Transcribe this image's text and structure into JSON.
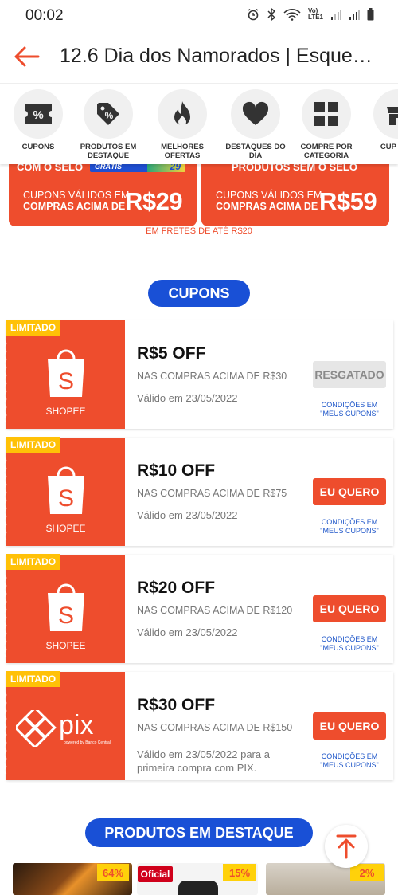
{
  "status_bar": {
    "time": "00:02",
    "network_label_top": "Vo)",
    "network_label_bottom": "LTE1"
  },
  "header": {
    "title": "12.6 Dia dos Namorados | Esque…"
  },
  "categories": [
    {
      "label": "CUPONS",
      "icon": "coupon-icon"
    },
    {
      "label": "PRODUTOS EM DESTAQUE",
      "icon": "price-tag-icon"
    },
    {
      "label": "MELHORES OFERTAS",
      "icon": "flame-icon"
    },
    {
      "label": "DESTAQUES DO DIA",
      "icon": "heart-icon"
    },
    {
      "label": "COMPRE POR CATEGORIA",
      "icon": "grid-icon"
    },
    {
      "label": "CUP DE L",
      "icon": "store-icon"
    }
  ],
  "banners": [
    {
      "top_text": "COM O SELO",
      "badge_text": "GRÁTIS",
      "badge_amount": "29",
      "line1": "CUPONS VÁLIDOS EM",
      "line2": "COMPRAS ACIMA DE",
      "amount": "R$29"
    },
    {
      "top_text": "PRODUTOS SEM O SELO",
      "line1": "CUPONS VÁLIDOS EM",
      "line2": "COMPRAS ACIMA DE",
      "amount": "R$59"
    }
  ],
  "frete_note": "EM FRETES DE ATÉ R$20",
  "sections": {
    "cupons": "CUPONS",
    "produtos_destaque": "PRODUTOS EM DESTAQUE"
  },
  "coupons": [
    {
      "badge": "LIMITADO",
      "brand": "SHOPEE",
      "amount": "R$5 OFF",
      "min": "NAS COMPRAS ACIMA DE R$30",
      "valid": "Válido em 23/05/2022",
      "button": "RESGATADO",
      "button_state": "claimed",
      "conditions": "CONDIÇÕES EM \"MEUS CUPONS\""
    },
    {
      "badge": "LIMITADO",
      "brand": "SHOPEE",
      "amount": "R$10 OFF",
      "min": "NAS COMPRAS ACIMA DE R$75",
      "valid": "Válido em 23/05/2022",
      "button": "EU QUERO",
      "button_state": "available",
      "conditions": "CONDIÇÕES EM \"MEUS CUPONS\""
    },
    {
      "badge": "LIMITADO",
      "brand": "SHOPEE",
      "amount": "R$20 OFF",
      "min": "NAS COMPRAS ACIMA DE R$120",
      "valid": "Válido em 23/05/2022",
      "button": "EU QUERO",
      "button_state": "available",
      "conditions": "CONDIÇÕES EM \"MEUS CUPONS\""
    },
    {
      "badge": "LIMITADO",
      "brand": "pix",
      "brand_sub": "powered by Banco Central",
      "amount": "R$30 OFF",
      "min": "NAS COMPRAS ACIMA DE R$150",
      "valid": "Válido em 23/05/2022 para a primeira compra com PIX.",
      "button": "EU QUERO",
      "button_state": "available",
      "conditions": "CONDIÇÕES EM \"MEUS CUPONS\""
    }
  ],
  "products": [
    {
      "discount": "64%"
    },
    {
      "label": "Oficial",
      "discount": "15%"
    },
    {
      "discount": "2%"
    }
  ],
  "colors": {
    "shopee_orange": "#ee4d2d",
    "pill_blue": "#1950d6",
    "limited_yellow": "#ffc107",
    "link_blue": "#1e56c9"
  }
}
